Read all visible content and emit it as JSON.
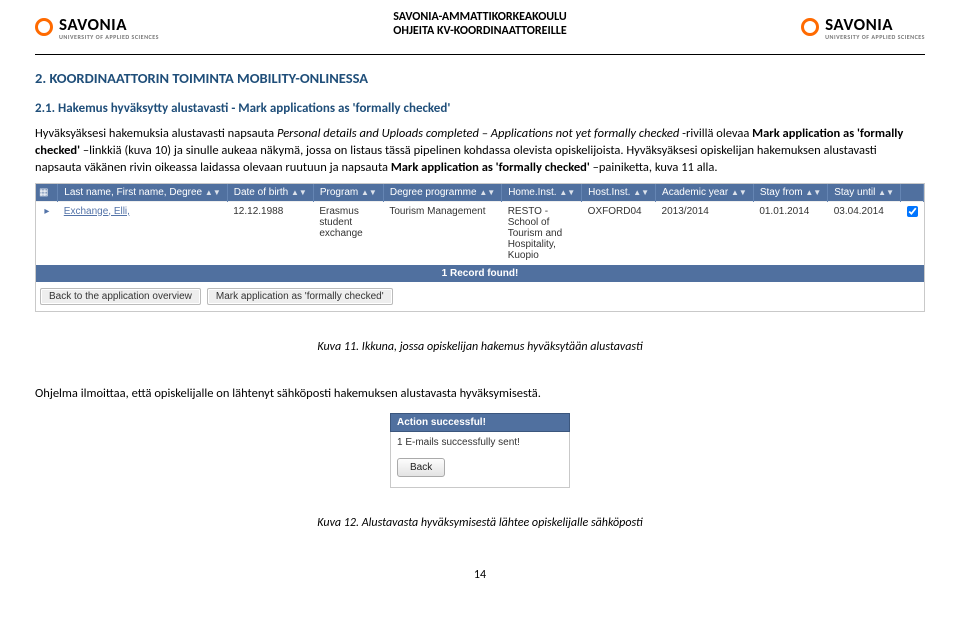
{
  "header": {
    "logo_name": "SAVONIA",
    "logo_sub": "UNIVERSITY OF APPLIED SCIENCES",
    "title1": "SAVONIA-AMMATTIKORKEAKOULU",
    "title2": "OHJEITA KV-KOORDINAATTOREILLE"
  },
  "section_heading": "2. KOORDINAATTORIN TOIMINTA MOBILITY-ONLINESSA",
  "subsection_heading": "2.1. Hakemus hyväksytty alustavasti - Mark applications as 'formally checked'",
  "para1_a": "Hyväksyäksesi hakemuksia alustavasti napsauta ",
  "para1_b": "Personal details and Uploads completed – Applications not yet formally checked ",
  "para1_c": "-rivillä olevaa ",
  "para1_d": "Mark application as 'formally checked'",
  "para1_e": " –linkkiä (kuva 10) ja sinulle aukeaa näkymä, jossa on listaus tässä pipelinen kohdassa olevista opiskelijoista. Hyväksyäksesi opiskelijan hakemuksen alustavasti napsauta väkänen rivin oikeassa laidassa olevaan ruutuun ja napsauta ",
  "para1_f": " –painiketta, kuva 11 alla.",
  "table": {
    "headers": {
      "checkbox": "",
      "name": "Last name, First name, Degree",
      "dob": "Date of birth",
      "program": "Program",
      "degprog": "Degree programme",
      "homeinst": "Home.Inst.",
      "hostinst": "Host.Inst.",
      "year": "Academic year",
      "from": "Stay from",
      "until": "Stay until"
    },
    "row": {
      "name": "Exchange, Elli,",
      "dob": "12.12.1988",
      "program": "Erasmus student exchange",
      "degprog": "Tourism Management",
      "homeinst": "RESTO - School of Tourism and Hospitality, Kuopio",
      "hostinst": "OXFORD04",
      "year": "2013/2014",
      "from": "01.01.2014",
      "until": "03.04.2014"
    },
    "records": "1 Record found!",
    "btn_back": "Back to the application overview",
    "btn_mark": "Mark application as 'formally checked'"
  },
  "caption1": "Kuva 11. Ikkuna, jossa opiskelijan hakemus hyväksytään alustavasti",
  "para2": "Ohjelma ilmoittaa, että opiskelijalle on lähtenyt sähköposti hakemuksen alustavasta hyväksymisestä.",
  "shot2": {
    "title": "Action successful!",
    "text": "1 E-mails successfully sent!",
    "back": "Back"
  },
  "caption2": "Kuva 12. Alustavasta hyväksymisestä lähtee opiskelijalle sähköposti",
  "page_number": "14"
}
